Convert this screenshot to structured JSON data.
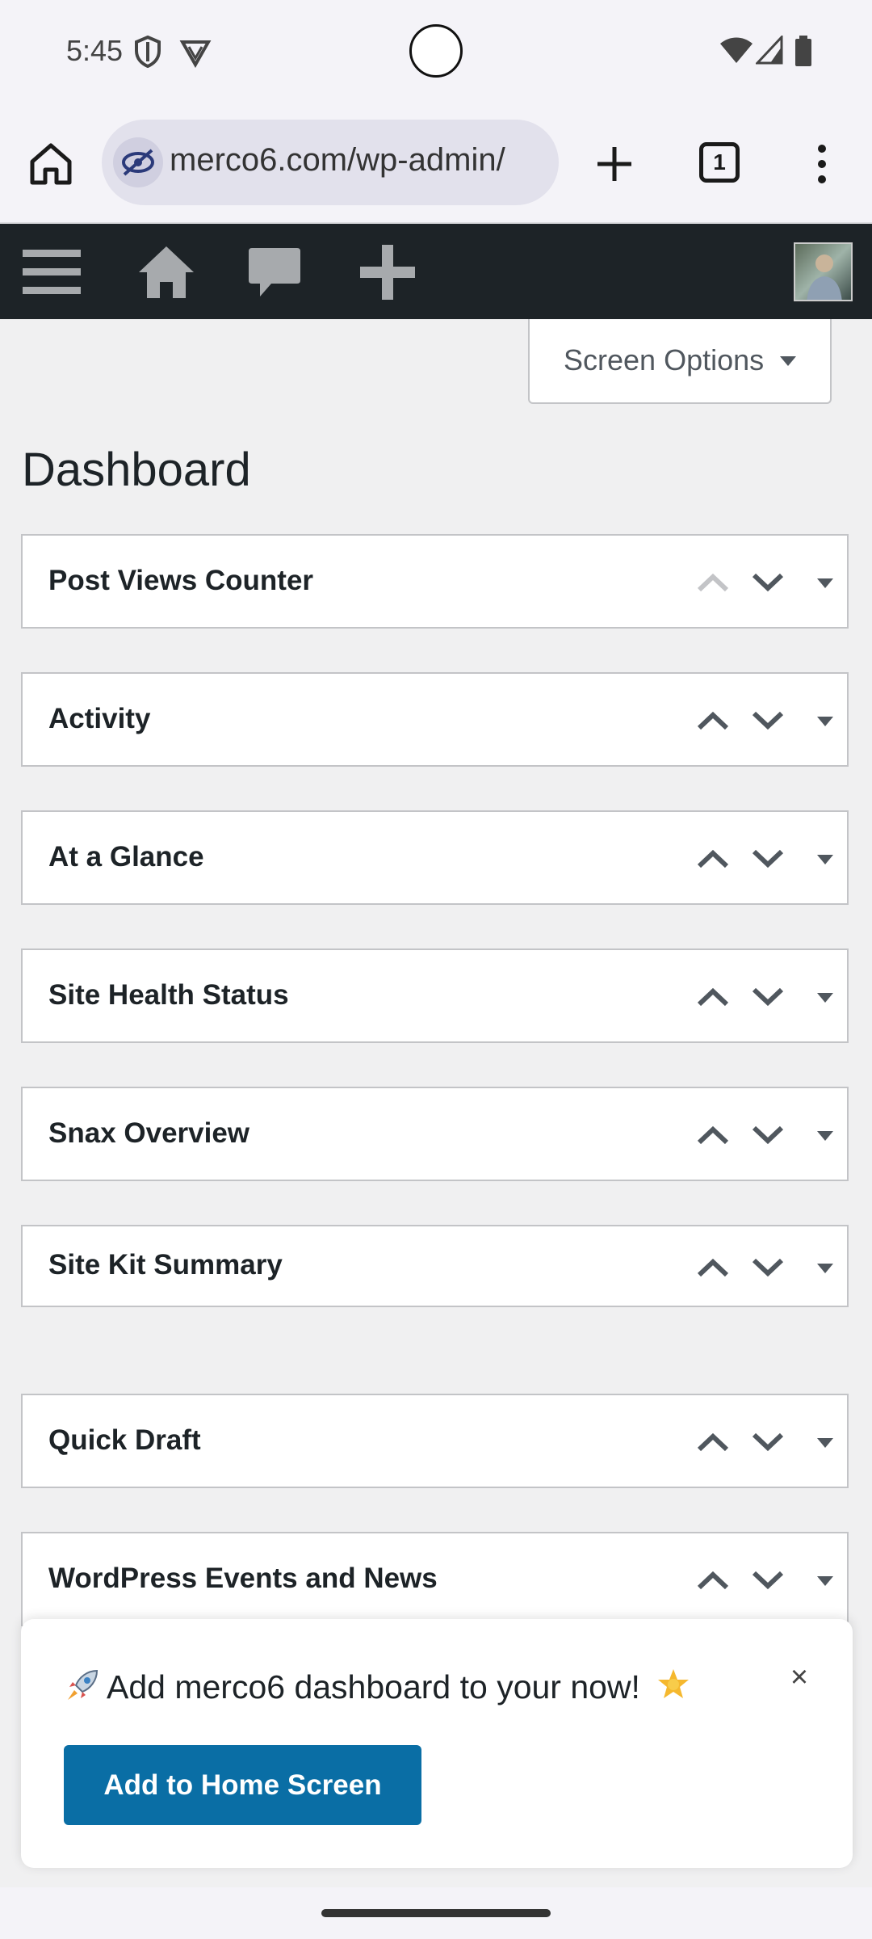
{
  "status_bar": {
    "time": "5:45",
    "icons": [
      "shield-icon",
      "vpn-icon",
      "wifi-icon",
      "signal-icon",
      "battery-icon"
    ]
  },
  "browser": {
    "url": "merco6.com/wp-admin/",
    "tab_count": "1",
    "icons": [
      "home-icon",
      "eye-off-icon",
      "plus-icon",
      "tabs-icon",
      "more-vert-icon"
    ]
  },
  "admin_bar": {
    "icons": [
      "menu-icon",
      "home-icon",
      "comment-icon",
      "plus-icon",
      "avatar"
    ]
  },
  "screen_options": {
    "label": "Screen Options"
  },
  "page": {
    "title": "Dashboard"
  },
  "postboxes": [
    {
      "title": "Post Views Counter",
      "up_disabled": true
    },
    {
      "title": "Activity",
      "up_disabled": false
    },
    {
      "title": "At a Glance",
      "up_disabled": false
    },
    {
      "title": "Site Health Status",
      "up_disabled": false
    },
    {
      "title": "Snax Overview",
      "up_disabled": false
    },
    {
      "title": "Site Kit Summary",
      "up_disabled": false
    },
    {
      "title": "Quick Draft",
      "up_disabled": false
    },
    {
      "title": "WordPress Events and News",
      "up_disabled": false
    }
  ],
  "install_prompt": {
    "message": "Add merco6 dashboard to your now!",
    "button_label": "Add to Home Screen",
    "close": "×"
  },
  "colors": {
    "admin_bar": "#1d2327",
    "accent": "#0a6ea5",
    "page_bg": "#f0f0f1"
  }
}
